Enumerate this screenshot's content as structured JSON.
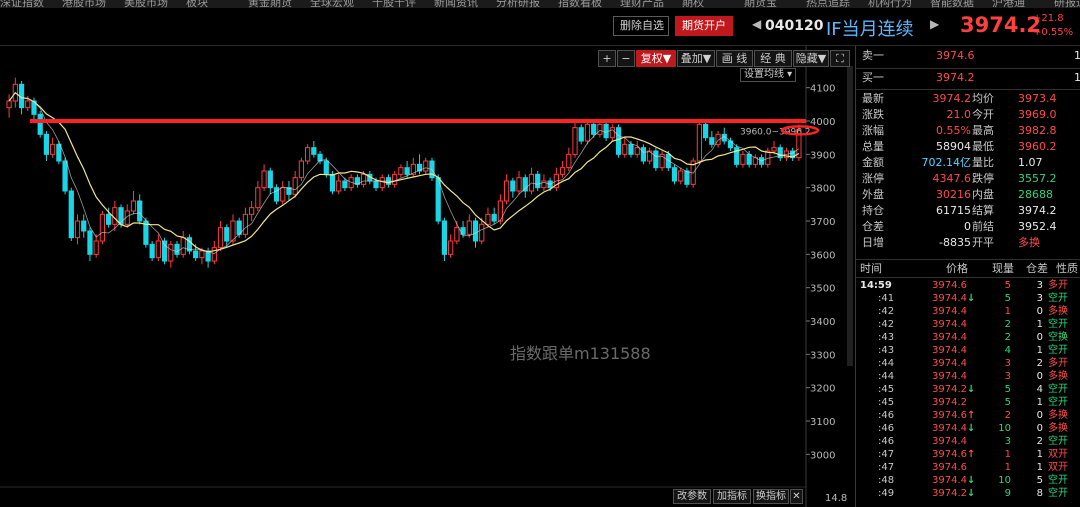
{
  "top_menu": [
    "深证指数",
    "港股市场",
    "美股市场",
    "板块",
    "黄金期货",
    "全球宏观",
    "千股千评",
    "新闻资讯",
    "分析研报",
    "指数看板",
    "理财产品",
    "期权",
    "期货宝",
    "热点追踪",
    "机构行为",
    "智能数据",
    "沪港通",
    "研报通"
  ],
  "header": {
    "delete_btn": "删除自选",
    "open_btn": "期货开户",
    "code": "040120",
    "name": "IF当月连续",
    "last": "3974.2",
    "change": "+21.8",
    "change_pct": "+0.55%"
  },
  "toolbar": {
    "plus": "+",
    "minus": "−",
    "fuquan": "复权▼",
    "diejia": "叠加▼",
    "huaxian": "画 线",
    "jingdian": "经 典",
    "yincang": "隐藏▼",
    "fullscreen": "⛶",
    "ma_setting": "设置均线 ▾"
  },
  "watermark": "指数跟单m131588",
  "annotation": "3960.0~3996.2",
  "bottom_toolbar": {
    "params": "改参数",
    "add_ind": "加指标",
    "switch_ind": "换指标",
    "close": "✕",
    "last_tick": "14.8"
  },
  "colors": {
    "up": "#ff3b3b",
    "down": "#19d6e6",
    "ma": "#f0e68c",
    "resistance": "#ff2222"
  },
  "chart_data": {
    "type": "candlestick",
    "title": "",
    "y_ticks": [
      3000,
      3100,
      3200,
      3300,
      3400,
      3500,
      3600,
      3700,
      3800,
      3900,
      4000,
      4100
    ],
    "ylim": [
      2905,
      4195
    ],
    "resistance_level": 4000,
    "candles": [
      {
        "o": 4040,
        "c": 4060,
        "h": 4080,
        "l": 4010
      },
      {
        "o": 4060,
        "c": 4110,
        "h": 4130,
        "l": 4040
      },
      {
        "o": 4110,
        "c": 4040,
        "h": 4120,
        "l": 4020
      },
      {
        "o": 4040,
        "c": 4060,
        "h": 4075,
        "l": 4030
      },
      {
        "o": 4060,
        "c": 4020,
        "h": 4070,
        "l": 4000
      },
      {
        "o": 4020,
        "c": 3960,
        "h": 4030,
        "l": 3950
      },
      {
        "o": 3960,
        "c": 3900,
        "h": 3970,
        "l": 3880
      },
      {
        "o": 3900,
        "c": 3930,
        "h": 3950,
        "l": 3890
      },
      {
        "o": 3930,
        "c": 3880,
        "h": 3940,
        "l": 3870
      },
      {
        "o": 3880,
        "c": 3790,
        "h": 3890,
        "l": 3780
      },
      {
        "o": 3790,
        "c": 3650,
        "h": 3800,
        "l": 3640
      },
      {
        "o": 3650,
        "c": 3700,
        "h": 3720,
        "l": 3630
      },
      {
        "o": 3700,
        "c": 3670,
        "h": 3720,
        "l": 3650
      },
      {
        "o": 3670,
        "c": 3600,
        "h": 3680,
        "l": 3580
      },
      {
        "o": 3600,
        "c": 3640,
        "h": 3660,
        "l": 3590
      },
      {
        "o": 3640,
        "c": 3720,
        "h": 3730,
        "l": 3630
      },
      {
        "o": 3720,
        "c": 3690,
        "h": 3740,
        "l": 3680
      },
      {
        "o": 3690,
        "c": 3740,
        "h": 3760,
        "l": 3670
      },
      {
        "o": 3740,
        "c": 3690,
        "h": 3750,
        "l": 3680
      },
      {
        "o": 3690,
        "c": 3730,
        "h": 3750,
        "l": 3680
      },
      {
        "o": 3730,
        "c": 3760,
        "h": 3790,
        "l": 3720
      },
      {
        "o": 3760,
        "c": 3700,
        "h": 3780,
        "l": 3690
      },
      {
        "o": 3700,
        "c": 3630,
        "h": 3710,
        "l": 3620
      },
      {
        "o": 3630,
        "c": 3590,
        "h": 3640,
        "l": 3580
      },
      {
        "o": 3590,
        "c": 3640,
        "h": 3660,
        "l": 3580
      },
      {
        "o": 3640,
        "c": 3580,
        "h": 3650,
        "l": 3570
      },
      {
        "o": 3580,
        "c": 3630,
        "h": 3640,
        "l": 3560
      },
      {
        "o": 3630,
        "c": 3600,
        "h": 3640,
        "l": 3590
      },
      {
        "o": 3600,
        "c": 3650,
        "h": 3670,
        "l": 3590
      },
      {
        "o": 3650,
        "c": 3610,
        "h": 3660,
        "l": 3600
      },
      {
        "o": 3610,
        "c": 3590,
        "h": 3630,
        "l": 3580
      },
      {
        "o": 3590,
        "c": 3610,
        "h": 3620,
        "l": 3570
      },
      {
        "o": 3610,
        "c": 3580,
        "h": 3620,
        "l": 3560
      },
      {
        "o": 3580,
        "c": 3620,
        "h": 3640,
        "l": 3570
      },
      {
        "o": 3620,
        "c": 3680,
        "h": 3700,
        "l": 3610
      },
      {
        "o": 3680,
        "c": 3640,
        "h": 3690,
        "l": 3620
      },
      {
        "o": 3640,
        "c": 3700,
        "h": 3720,
        "l": 3630
      },
      {
        "o": 3700,
        "c": 3660,
        "h": 3710,
        "l": 3650
      },
      {
        "o": 3660,
        "c": 3720,
        "h": 3740,
        "l": 3650
      },
      {
        "o": 3720,
        "c": 3740,
        "h": 3760,
        "l": 3700
      },
      {
        "o": 3740,
        "c": 3800,
        "h": 3820,
        "l": 3730
      },
      {
        "o": 3800,
        "c": 3850,
        "h": 3870,
        "l": 3790
      },
      {
        "o": 3850,
        "c": 3800,
        "h": 3860,
        "l": 3780
      },
      {
        "o": 3800,
        "c": 3760,
        "h": 3810,
        "l": 3750
      },
      {
        "o": 3760,
        "c": 3800,
        "h": 3820,
        "l": 3750
      },
      {
        "o": 3800,
        "c": 3780,
        "h": 3820,
        "l": 3760
      },
      {
        "o": 3780,
        "c": 3830,
        "h": 3850,
        "l": 3770
      },
      {
        "o": 3830,
        "c": 3880,
        "h": 3890,
        "l": 3820
      },
      {
        "o": 3880,
        "c": 3920,
        "h": 3930,
        "l": 3870
      },
      {
        "o": 3920,
        "c": 3900,
        "h": 3940,
        "l": 3890
      },
      {
        "o": 3900,
        "c": 3880,
        "h": 3910,
        "l": 3870
      },
      {
        "o": 3880,
        "c": 3840,
        "h": 3890,
        "l": 3830
      },
      {
        "o": 3840,
        "c": 3790,
        "h": 3850,
        "l": 3780
      },
      {
        "o": 3790,
        "c": 3820,
        "h": 3840,
        "l": 3780
      },
      {
        "o": 3820,
        "c": 3800,
        "h": 3830,
        "l": 3790
      },
      {
        "o": 3800,
        "c": 3830,
        "h": 3840,
        "l": 3790
      },
      {
        "o": 3830,
        "c": 3810,
        "h": 3840,
        "l": 3800
      },
      {
        "o": 3810,
        "c": 3840,
        "h": 3850,
        "l": 3800
      },
      {
        "o": 3840,
        "c": 3820,
        "h": 3850,
        "l": 3810
      },
      {
        "o": 3820,
        "c": 3800,
        "h": 3830,
        "l": 3790
      },
      {
        "o": 3800,
        "c": 3830,
        "h": 3840,
        "l": 3790
      },
      {
        "o": 3830,
        "c": 3810,
        "h": 3840,
        "l": 3800
      },
      {
        "o": 3810,
        "c": 3840,
        "h": 3850,
        "l": 3800
      },
      {
        "o": 3840,
        "c": 3860,
        "h": 3870,
        "l": 3830
      },
      {
        "o": 3860,
        "c": 3840,
        "h": 3880,
        "l": 3830
      },
      {
        "o": 3840,
        "c": 3870,
        "h": 3890,
        "l": 3830
      },
      {
        "o": 3870,
        "c": 3850,
        "h": 3900,
        "l": 3840
      },
      {
        "o": 3850,
        "c": 3880,
        "h": 3890,
        "l": 3840
      },
      {
        "o": 3880,
        "c": 3830,
        "h": 3890,
        "l": 3820
      },
      {
        "o": 3830,
        "c": 3700,
        "h": 3840,
        "l": 3690
      },
      {
        "o": 3700,
        "c": 3600,
        "h": 3710,
        "l": 3580
      },
      {
        "o": 3600,
        "c": 3640,
        "h": 3660,
        "l": 3590
      },
      {
        "o": 3640,
        "c": 3680,
        "h": 3700,
        "l": 3630
      },
      {
        "o": 3680,
        "c": 3660,
        "h": 3700,
        "l": 3650
      },
      {
        "o": 3660,
        "c": 3700,
        "h": 3720,
        "l": 3650
      },
      {
        "o": 3700,
        "c": 3640,
        "h": 3710,
        "l": 3620
      },
      {
        "o": 3640,
        "c": 3690,
        "h": 3710,
        "l": 3630
      },
      {
        "o": 3690,
        "c": 3720,
        "h": 3740,
        "l": 3680
      },
      {
        "o": 3720,
        "c": 3700,
        "h": 3740,
        "l": 3690
      },
      {
        "o": 3700,
        "c": 3760,
        "h": 3780,
        "l": 3690
      },
      {
        "o": 3760,
        "c": 3820,
        "h": 3840,
        "l": 3750
      },
      {
        "o": 3820,
        "c": 3790,
        "h": 3830,
        "l": 3770
      },
      {
        "o": 3790,
        "c": 3830,
        "h": 3850,
        "l": 3780
      },
      {
        "o": 3830,
        "c": 3790,
        "h": 3840,
        "l": 3770
      },
      {
        "o": 3790,
        "c": 3840,
        "h": 3860,
        "l": 3780
      },
      {
        "o": 3840,
        "c": 3800,
        "h": 3850,
        "l": 3790
      },
      {
        "o": 3800,
        "c": 3820,
        "h": 3840,
        "l": 3790
      },
      {
        "o": 3820,
        "c": 3800,
        "h": 3830,
        "l": 3790
      },
      {
        "o": 3800,
        "c": 3840,
        "h": 3860,
        "l": 3790
      },
      {
        "o": 3840,
        "c": 3860,
        "h": 3880,
        "l": 3830
      },
      {
        "o": 3860,
        "c": 3900,
        "h": 3920,
        "l": 3850
      },
      {
        "o": 3900,
        "c": 3980,
        "h": 4000,
        "l": 3890
      },
      {
        "o": 3980,
        "c": 3940,
        "h": 3990,
        "l": 3930
      },
      {
        "o": 3940,
        "c": 3990,
        "h": 4000,
        "l": 3930
      },
      {
        "o": 3990,
        "c": 3960,
        "h": 4000,
        "l": 3950
      },
      {
        "o": 3960,
        "c": 3990,
        "h": 4000,
        "l": 3950
      },
      {
        "o": 3990,
        "c": 3950,
        "h": 4000,
        "l": 3940
      },
      {
        "o": 3950,
        "c": 3980,
        "h": 3990,
        "l": 3940
      },
      {
        "o": 3980,
        "c": 3900,
        "h": 3990,
        "l": 3890
      },
      {
        "o": 3900,
        "c": 3930,
        "h": 3950,
        "l": 3890
      },
      {
        "o": 3930,
        "c": 3900,
        "h": 3940,
        "l": 3890
      },
      {
        "o": 3900,
        "c": 3920,
        "h": 3940,
        "l": 3890
      },
      {
        "o": 3920,
        "c": 3880,
        "h": 3930,
        "l": 3870
      },
      {
        "o": 3880,
        "c": 3910,
        "h": 3920,
        "l": 3870
      },
      {
        "o": 3910,
        "c": 3860,
        "h": 3920,
        "l": 3850
      },
      {
        "o": 3860,
        "c": 3900,
        "h": 3910,
        "l": 3850
      },
      {
        "o": 3900,
        "c": 3860,
        "h": 3910,
        "l": 3850
      },
      {
        "o": 3860,
        "c": 3820,
        "h": 3870,
        "l": 3810
      },
      {
        "o": 3820,
        "c": 3850,
        "h": 3860,
        "l": 3810
      },
      {
        "o": 3850,
        "c": 3810,
        "h": 3860,
        "l": 3800
      },
      {
        "o": 3810,
        "c": 3880,
        "h": 3890,
        "l": 3800
      },
      {
        "o": 3880,
        "c": 3990,
        "h": 4000,
        "l": 3870
      },
      {
        "o": 3990,
        "c": 3950,
        "h": 4000,
        "l": 3940
      },
      {
        "o": 3950,
        "c": 3930,
        "h": 3970,
        "l": 3920
      },
      {
        "o": 3930,
        "c": 3960,
        "h": 3970,
        "l": 3920
      },
      {
        "o": 3960,
        "c": 3940,
        "h": 3980,
        "l": 3930
      },
      {
        "o": 3940,
        "c": 3920,
        "h": 3950,
        "l": 3910
      },
      {
        "o": 3920,
        "c": 3870,
        "h": 3930,
        "l": 3860
      },
      {
        "o": 3870,
        "c": 3900,
        "h": 3910,
        "l": 3860
      },
      {
        "o": 3900,
        "c": 3870,
        "h": 3910,
        "l": 3860
      },
      {
        "o": 3870,
        "c": 3890,
        "h": 3900,
        "l": 3860
      },
      {
        "o": 3890,
        "c": 3870,
        "h": 3900,
        "l": 3860
      },
      {
        "o": 3870,
        "c": 3910,
        "h": 3920,
        "l": 3860
      },
      {
        "o": 3910,
        "c": 3920,
        "h": 3940,
        "l": 3900
      },
      {
        "o": 3920,
        "c": 3890,
        "h": 3930,
        "l": 3880
      },
      {
        "o": 3890,
        "c": 3910,
        "h": 3920,
        "l": 3880
      },
      {
        "o": 3910,
        "c": 3890,
        "h": 3920,
        "l": 3880
      },
      {
        "o": 3890,
        "c": 3974,
        "h": 3990,
        "l": 3880
      }
    ]
  },
  "quote": {
    "sell1": {
      "label": "卖一",
      "price": "3974.6",
      "vol": "1"
    },
    "buy1": {
      "label": "买一",
      "price": "3974.2",
      "vol": "1"
    },
    "rows": [
      {
        "l1": "最新",
        "v1": "3974.2",
        "l2": "均价",
        "v2": "3973.4",
        "c1": "red",
        "c2": "red"
      },
      {
        "l1": "涨跌",
        "v1": "21.0",
        "l2": "今开",
        "v2": "3969.0",
        "c1": "red",
        "c2": "red"
      },
      {
        "l1": "涨幅",
        "v1": "0.55%",
        "l2": "最高",
        "v2": "3982.8",
        "c1": "red",
        "c2": "red"
      },
      {
        "l1": "总量",
        "v1": "58904",
        "l2": "最低",
        "v2": "3960.2",
        "c1": "wht",
        "c2": "red"
      },
      {
        "l1": "金额",
        "v1": "702.14亿",
        "l2": "量比",
        "v2": "1.07",
        "c1": "cyan",
        "c2": "wht"
      },
      {
        "l1": "涨停",
        "v1": "4347.6",
        "l2": "跌停",
        "v2": "3557.2",
        "c1": "red",
        "c2": "grn"
      },
      {
        "l1": "外盘",
        "v1": "30216",
        "l2": "内盘",
        "v2": "28688",
        "c1": "red",
        "c2": "grn"
      },
      {
        "l1": "持仓",
        "v1": "61715",
        "l2": "结算",
        "v2": "3974.2",
        "c1": "wht",
        "c2": "wht"
      },
      {
        "l1": "仓差",
        "v1": "0",
        "l2": "前结",
        "v2": "3952.4",
        "c1": "wht",
        "c2": "wht"
      },
      {
        "l1": "日增",
        "v1": "-8835",
        "l2": "开平",
        "v2": "多换",
        "c1": "wht",
        "c2": "red"
      }
    ]
  },
  "ticks_header": {
    "time": "时间",
    "price": "价格",
    "vol": "现量",
    "oi": "仓差",
    "type": "性质"
  },
  "ticks": [
    {
      "t": "14:59",
      "p": "3974.6",
      "a": "",
      "v": "5",
      "o": "3",
      "k": "多开",
      "pc": "red",
      "vc": "red",
      "kc": "red"
    },
    {
      "t": ":41",
      "p": "3974.4",
      "a": "↓",
      "v": "5",
      "o": "3",
      "k": "空开",
      "pc": "red",
      "vc": "grn",
      "kc": "grn"
    },
    {
      "t": ":42",
      "p": "3974.4",
      "a": "",
      "v": "1",
      "o": "0",
      "k": "多换",
      "pc": "red",
      "vc": "red",
      "kc": "red"
    },
    {
      "t": ":42",
      "p": "3974.4",
      "a": "",
      "v": "2",
      "o": "1",
      "k": "空开",
      "pc": "red",
      "vc": "grn",
      "kc": "grn"
    },
    {
      "t": ":43",
      "p": "3974.4",
      "a": "",
      "v": "2",
      "o": "0",
      "k": "空换",
      "pc": "red",
      "vc": "grn",
      "kc": "grn"
    },
    {
      "t": ":43",
      "p": "3974.4",
      "a": "",
      "v": "4",
      "o": "1",
      "k": "空开",
      "pc": "red",
      "vc": "grn",
      "kc": "grn"
    },
    {
      "t": ":44",
      "p": "3974.4",
      "a": "",
      "v": "3",
      "o": "2",
      "k": "多开",
      "pc": "red",
      "vc": "red",
      "kc": "red"
    },
    {
      "t": ":44",
      "p": "3974.4",
      "a": "",
      "v": "3",
      "o": "0",
      "k": "多换",
      "pc": "red",
      "vc": "red",
      "kc": "red"
    },
    {
      "t": ":45",
      "p": "3974.2",
      "a": "↓",
      "v": "5",
      "o": "4",
      "k": "空开",
      "pc": "red",
      "vc": "grn",
      "kc": "grn"
    },
    {
      "t": ":45",
      "p": "3974.2",
      "a": "",
      "v": "5",
      "o": "1",
      "k": "空开",
      "pc": "red",
      "vc": "grn",
      "kc": "grn"
    },
    {
      "t": ":46",
      "p": "3974.6",
      "a": "↑",
      "v": "2",
      "o": "0",
      "k": "多换",
      "pc": "red",
      "vc": "red",
      "kc": "red"
    },
    {
      "t": ":46",
      "p": "3974.4",
      "a": "↓",
      "v": "10",
      "o": "0",
      "k": "多换",
      "pc": "red",
      "vc": "grn",
      "kc": "red"
    },
    {
      "t": ":46",
      "p": "3974.4",
      "a": "",
      "v": "3",
      "o": "2",
      "k": "空开",
      "pc": "red",
      "vc": "grn",
      "kc": "grn"
    },
    {
      "t": ":47",
      "p": "3974.6",
      "a": "↑",
      "v": "1",
      "o": "1",
      "k": "双开",
      "pc": "red",
      "vc": "red",
      "kc": "red"
    },
    {
      "t": ":47",
      "p": "3974.6",
      "a": "",
      "v": "1",
      "o": "1",
      "k": "双开",
      "pc": "red",
      "vc": "red",
      "kc": "red"
    },
    {
      "t": ":48",
      "p": "3974.4",
      "a": "↓",
      "v": "10",
      "o": "5",
      "k": "空开",
      "pc": "red",
      "vc": "grn",
      "kc": "grn"
    },
    {
      "t": ":49",
      "p": "3974.2",
      "a": "↓",
      "v": "9",
      "o": "8",
      "k": "空开",
      "pc": "red",
      "vc": "grn",
      "kc": "grn"
    }
  ]
}
